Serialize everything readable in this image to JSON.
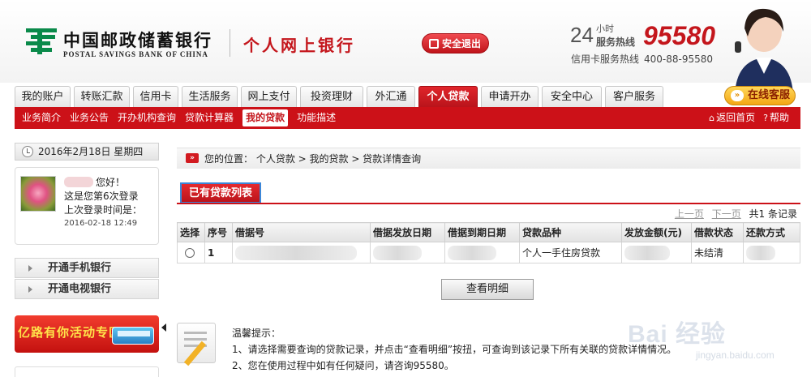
{
  "header": {
    "bank_name_cn": "中国邮政储蓄银行",
    "bank_name_en": "POSTAL SAVINGS BANK OF CHINA",
    "site_name": "个人网上银行",
    "logout_label": "安全退出",
    "hotline_24": "24",
    "hotline_label_top": "小时",
    "hotline_label_bottom": "服务热线",
    "hotline_number": "95580",
    "card_hotline_label": "信用卡服务热线",
    "card_hotline_number": "400-88-95580",
    "online_service_label": "在线客服"
  },
  "tabs": [
    {
      "label": "我的账户",
      "active": false
    },
    {
      "label": "转账汇款",
      "active": false
    },
    {
      "label": "信用卡",
      "active": false
    },
    {
      "label": "生活服务",
      "active": false
    },
    {
      "label": "网上支付",
      "active": false
    },
    {
      "label": "投资理财",
      "active": false
    },
    {
      "label": "外汇通",
      "active": false
    },
    {
      "label": "个人贷款",
      "active": true
    },
    {
      "label": "申请开办",
      "active": false
    },
    {
      "label": "安全中心",
      "active": false
    },
    {
      "label": "客户服务",
      "active": false
    }
  ],
  "subnav": {
    "items": [
      {
        "label": "业务简介",
        "selected": false
      },
      {
        "label": "业务公告",
        "selected": false
      },
      {
        "label": "开办机构查询",
        "selected": false
      },
      {
        "label": "贷款计算器",
        "selected": false
      },
      {
        "label": "我的贷款",
        "selected": true
      },
      {
        "label": "功能描述",
        "selected": false
      }
    ],
    "home_label": "返回首页",
    "help_label": "帮助"
  },
  "left": {
    "date": "2016年2月18日 星期四",
    "greeting": "您好！",
    "login_count": "这是您第6次登录",
    "last_login_label": "上次登录时间是：",
    "last_login_time": "2016-02-18 12:49",
    "menu": [
      "开通手机银行",
      "开通电视银行"
    ],
    "promo_text": "亿路有你活动专区"
  },
  "main": {
    "breadcrumb": "您的位置： 个人贷款 > 我的贷款 > 贷款详情查询",
    "list_tab": "已有贷款列表",
    "pager": {
      "prev": "上一页",
      "next": "下一页",
      "total": "共1 条记录"
    },
    "table": {
      "headers": [
        "选择",
        "序号",
        "借据号",
        "借据发放日期",
        "借据到期日期",
        "贷款品种",
        "发放金额(元)",
        "借款状态",
        "还款方式"
      ],
      "rows": [
        {
          "index": "1",
          "product": "个人一手住房贷款",
          "status": "未结清"
        }
      ]
    },
    "detail_button": "查看明细",
    "tips_title": "温馨提示：",
    "tips": [
      "1、请选择需要查询的贷款记录，并点击“查看明细”按扭，可查询到该记录下所有关联的贷款详情情况。",
      "2、您在使用过程中如有任何疑问，请咨询95580。"
    ]
  },
  "watermark": {
    "text": "Bai 经验",
    "url": "jingyan.baidu.com"
  }
}
